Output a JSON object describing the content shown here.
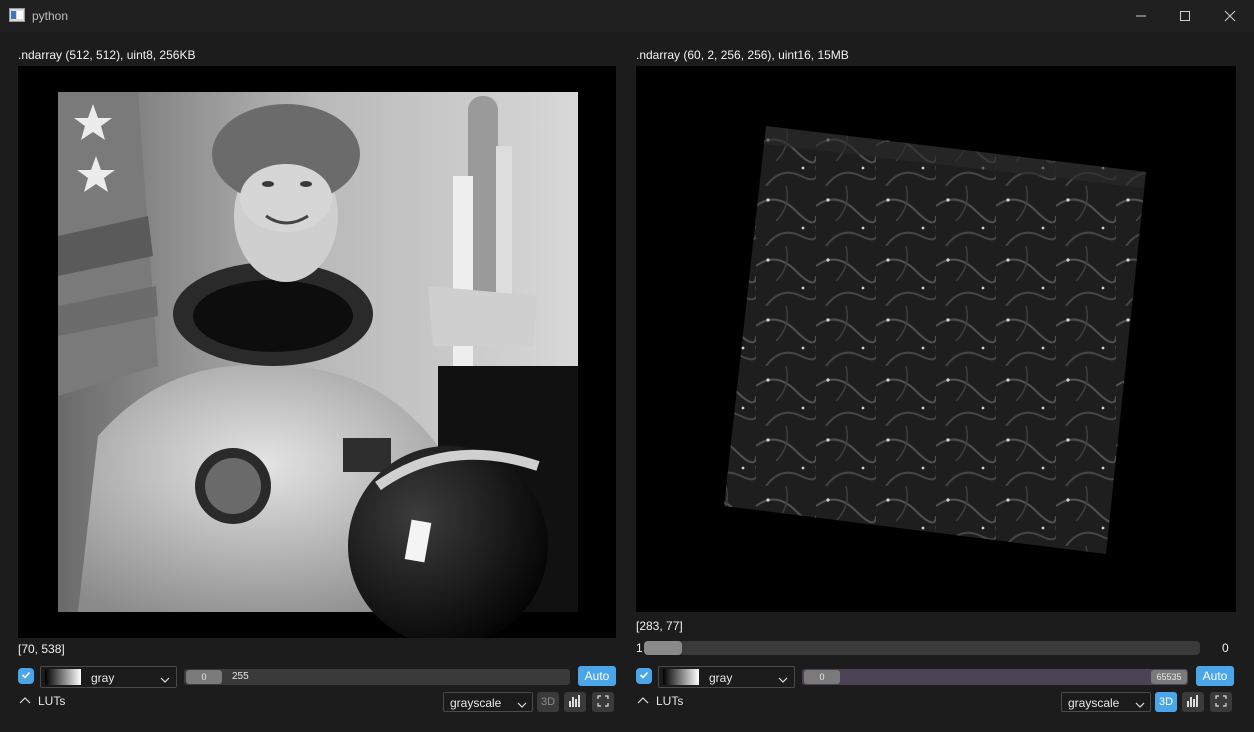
{
  "window": {
    "title": "python"
  },
  "left_pane": {
    "header": ".ndarray (512, 512), uint8, 256KB",
    "coords": "[70, 538]",
    "colormap": "gray",
    "clim_min": "0",
    "clim_max": "255",
    "auto_label": "Auto",
    "luts_label": "LUTs",
    "mode_select": "grayscale",
    "btn_3d": "3D"
  },
  "right_pane": {
    "header": ".ndarray (60, 2, 256, 256), uint16, 15MB",
    "coords": "[283, 77]",
    "step_start": "1",
    "step_end": "0",
    "colormap": "gray",
    "clim_min": "0",
    "clim_max": "65535",
    "auto_label": "Auto",
    "luts_label": "LUTs",
    "mode_select": "grayscale",
    "btn_3d": "3D"
  },
  "colors": {
    "accent": "#4aa6e8",
    "background": "#1c1c1c",
    "titlebar": "#202020"
  },
  "icons": [
    "app-icon",
    "minimize-icon",
    "maximize-icon",
    "close-icon",
    "check-icon",
    "chevron-down-icon",
    "chevron-up-icon",
    "histogram-icon",
    "fullscreen-icon"
  ]
}
